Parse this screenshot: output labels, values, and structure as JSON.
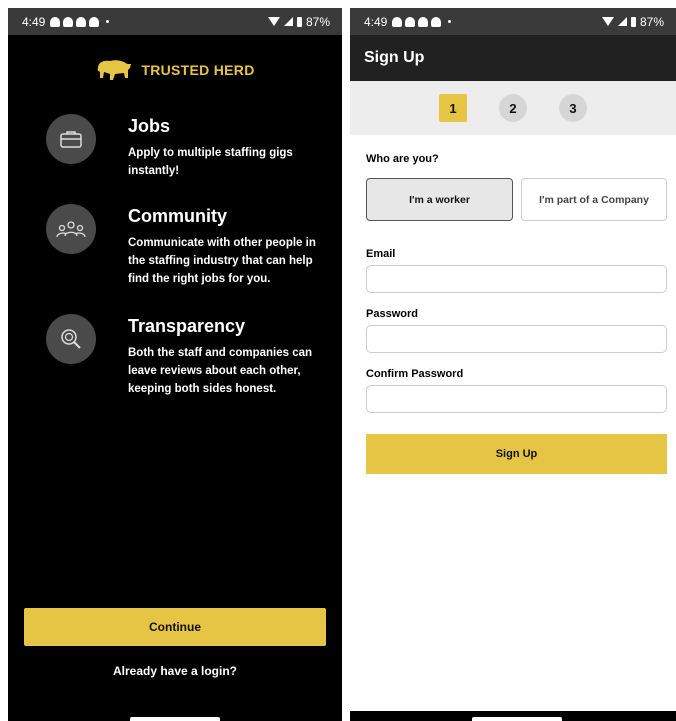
{
  "left": {
    "status": {
      "time": "4:49",
      "battery": "87%"
    },
    "brand": {
      "name": "TRUSTED HERD",
      "color": "#e7c544"
    },
    "features": [
      {
        "icon": "briefcase-icon",
        "title": "Jobs",
        "description": "Apply to multiple staffing gigs instantly!"
      },
      {
        "icon": "community-icon",
        "title": "Community",
        "description": "Communicate with other people in the staffing industry that can help find the right jobs for you."
      },
      {
        "icon": "search-icon",
        "title": "Transparency",
        "description": "Both the staff and companies can leave reviews about each other, keeping both sides honest."
      }
    ],
    "continue_label": "Continue",
    "login_link": "Already have a login?"
  },
  "right": {
    "status": {
      "time": "4:49",
      "battery": "87%"
    },
    "appbar_title": "Sign Up",
    "steps": [
      "1",
      "2",
      "3"
    ],
    "active_step": 0,
    "who_label": "Who are you?",
    "worker_label": "I'm a worker",
    "company_label": "I'm part of a Company",
    "email_label": "Email",
    "email_value": "",
    "password_label": "Password",
    "password_value": "",
    "confirm_label": "Confirm Password",
    "confirm_value": "",
    "signup_label": "Sign Up"
  }
}
